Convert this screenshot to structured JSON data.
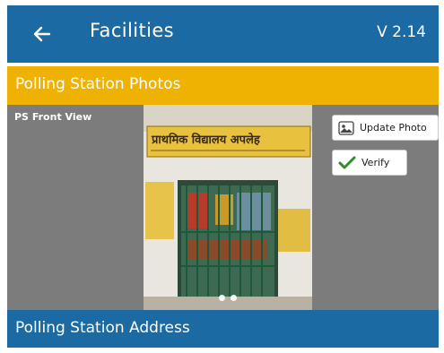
{
  "appbar": {
    "back_icon": "arrow-back-icon",
    "title": "Facilities",
    "version": "V 2.14"
  },
  "sections": {
    "photos_header": "Polling Station Photos",
    "address_header": "Polling Station Address"
  },
  "photo_card": {
    "label": "PS Front View",
    "sign_text": "प्राथमिक विद्यालय अपलेह",
    "carousel_dots": 2
  },
  "actions": {
    "update_photo": "Update Photo",
    "verify": "Verify"
  },
  "colors": {
    "primary": "#1b6aa3",
    "accent": "#f0b202",
    "panel": "#7c7c7c",
    "verify_check": "#2e8b2e"
  }
}
